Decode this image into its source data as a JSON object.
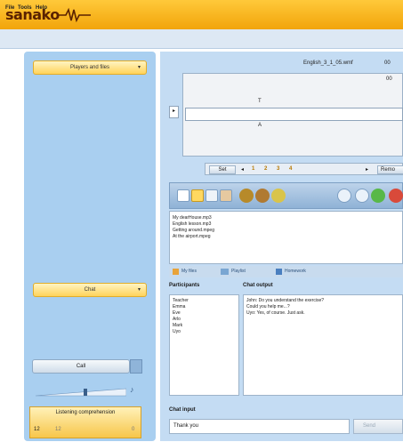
{
  "app": {
    "logo_text": "sanako"
  },
  "menu": [
    "File",
    "Tools",
    "Help"
  ],
  "left_panel": {
    "activity_button": "Players and files",
    "chat_button": "Chat",
    "call_button": "Call",
    "volume_icon": "speaker-icon",
    "status_box": {
      "title": "Listening comprehension",
      "left_value": "12",
      "right_value": "12",
      "last_value": "0"
    }
  },
  "player": {
    "filename": "English_3_1_05.wmf",
    "filename_suffix": "00",
    "corner_label": "00",
    "track_label_top": "T",
    "track_label_bottom": "A",
    "bookmarks": {
      "set_label": "Set",
      "prev_arrow": "◂",
      "numbers": [
        "1",
        "2",
        "3",
        "4"
      ],
      "next_arrow": "▸",
      "remove_label": "Remo"
    },
    "files": [
      "My dearHouse.mp3",
      "English lesson.mp3",
      "Getting around.mpeg",
      "At the airport.mpeg"
    ]
  },
  "tabs": [
    "My files",
    "Playlist",
    "Homework"
  ],
  "participants": {
    "label": "Participants",
    "names": [
      "Teacher",
      "Emma",
      "Eve",
      "Arlo",
      "Mark",
      "Uyo"
    ]
  },
  "chat": {
    "output_label": "Chat output",
    "lines": [
      "John: Do you understand the exercise?",
      "Could you help me...?",
      "Uyo: Yes, of course. Just ask."
    ],
    "input_label": "Chat input",
    "input_value": "Thank you",
    "send_label": "Send"
  },
  "colors": {
    "brand_orange": "#f6b21c",
    "panel_blue": "#a9cff0",
    "button_yellow": "#ffd35a"
  }
}
